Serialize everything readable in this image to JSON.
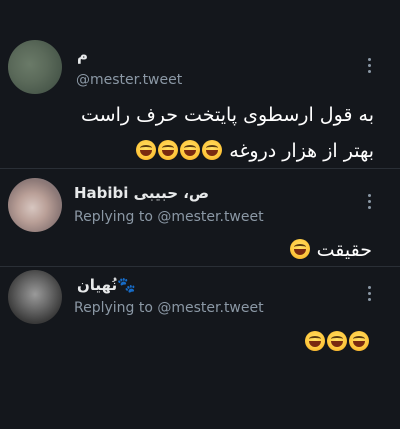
{
  "tweets": [
    {
      "display_name": "م",
      "handle": "@mester.tweet",
      "text_line_1": "به قول ارسطوی پایتخت حرف راست",
      "text_line_2": "بهتر از هزار دروغه",
      "emoji": "grinning-face-with-sweat"
    },
    {
      "display_name": "Habibi ص، حبیبی",
      "replying_to": "Replying to @mester.tweet",
      "text": "حقیقت",
      "emoji": "grinning-face-with-sweat"
    },
    {
      "display_name": "نُهیان🐾",
      "replying_to": "Replying to @mester.tweet",
      "emoji": "grinning-face-with-sweat"
    }
  ],
  "colors": {
    "background": "#14171c",
    "divider": "#2a2f36",
    "primary_text": "#ffffff",
    "secondary_text": "#8b98a5"
  }
}
